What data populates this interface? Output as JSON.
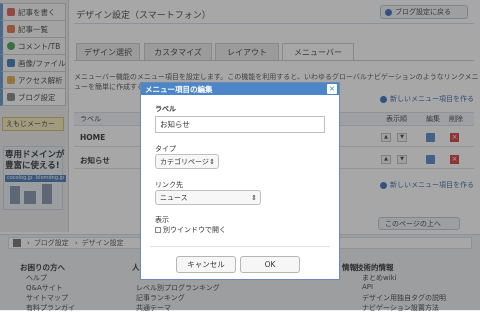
{
  "sidebar": {
    "items": [
      {
        "label": "記事を書く",
        "icon": "pencil-icon",
        "color": "#d9534f"
      },
      {
        "label": "記事一覧",
        "icon": "list-icon",
        "color": "#e06b3a"
      },
      {
        "label": "コメント/TB",
        "icon": "comment-icon",
        "color": "#3a9a4a"
      },
      {
        "label": "画像/ファイル",
        "icon": "image-icon",
        "color": "#2f6db5"
      },
      {
        "label": "アクセス解析",
        "icon": "chart-icon",
        "color": "#e0a53a"
      },
      {
        "label": "ブログ設定",
        "icon": "wrench-icon",
        "color": "#7a7a7a"
      }
    ],
    "emoji_label": "えもじメーカー",
    "ad": {
      "line1": "専用ドメインが",
      "line2": "豊富に使える!",
      "tag1": "cocolog.jp",
      "tag2": "blomdng.jp"
    }
  },
  "header": {
    "title": "デザイン設定（スマートフォン）",
    "back_button": "ブログ設定に戻る"
  },
  "tabs": [
    "デザイン選択",
    "カスタマイズ",
    "レイアウト",
    "メニューバー"
  ],
  "description": {
    "line1": "メニューバー機能のメニュー項目を設定します。この機能を利用すると、いわゆるグローバルナビゲーションのようなリンクメニ",
    "line2": "ューを簡単に作成するこ"
  },
  "new_item_link": "新しいメニュー項目を作る",
  "table": {
    "headers": {
      "label": "ラベル",
      "order": "表示順",
      "edit": "編集",
      "delete": "削除"
    },
    "rows": [
      {
        "label": "HOME"
      },
      {
        "label": "お知らせ"
      }
    ]
  },
  "back_to_top": "このページの上へ",
  "footer": {
    "breadcrumb": [
      "ブログ設定",
      "デザイン設定"
    ],
    "columns": [
      {
        "heading": "お困りの方へ",
        "items": [
          "ヘルプ",
          "Q&Aサイト",
          "サイトマップ",
          "有料プランガイ"
        ]
      },
      {
        "heading": "人",
        "items": [
          "レベル別プログランキング",
          "記事ランキング",
          "共通テーマ"
        ]
      },
      {
        "heading": "情報",
        "items": []
      },
      {
        "heading": "技術的情報",
        "items": [
          "まとめwiki",
          "API",
          "デザイン用独自タグの説明",
          "ナビゲーション設置方法"
        ]
      }
    ]
  },
  "modal": {
    "title": "メニュー項目の編集",
    "close": "×",
    "label_field": {
      "label": "ラベル",
      "value": "お知らせ"
    },
    "type_field": {
      "label": "タイプ",
      "value": "カテゴリページ"
    },
    "link_field": {
      "label": "リンク先",
      "value": "ニュース"
    },
    "display": {
      "label": "表示",
      "checkbox_label": "別ウインドウで開く",
      "checked": false
    },
    "cancel": "キャンセル",
    "ok": "OK"
  }
}
